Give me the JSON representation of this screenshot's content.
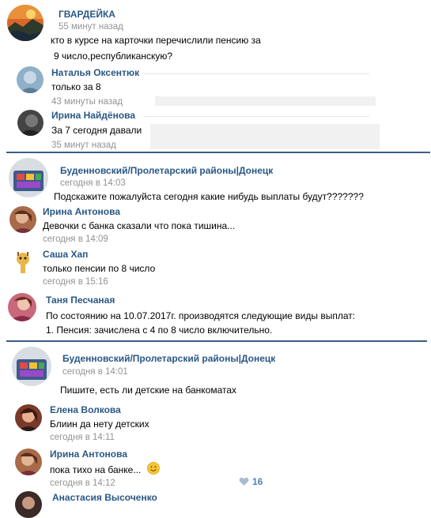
{
  "colors": {
    "link": "#2a5885",
    "time": "#939393",
    "separator": "#3a5f85",
    "like": "#5181b8"
  },
  "post1": {
    "author": "ГВАРДЕЙКА",
    "time": "55 минут назад",
    "text_line1": "кто в курсе на карточки перечислили пенсию за",
    "text_line2": "9 число,республиканскую?",
    "replies": [
      {
        "name": "Наталья Оксентюк",
        "text": "только за 8",
        "time": "43 минуты назад"
      },
      {
        "name": "Ирина Найдёнова",
        "text": "За 7 сегодня давали",
        "time": "35 минут назад"
      }
    ]
  },
  "post2": {
    "author": "Буденновский/Пролетарский районы|Донецк",
    "time": "сегодня в 14:03",
    "text": "Подскажите пожалуйста сегодня какие нибудь выплаты будут???????",
    "replies": [
      {
        "name": "Ирина Антонова",
        "text": "Девочки с банка сказали что пока тишина...",
        "time": "сегодня в 14:09"
      },
      {
        "name": "Саша Хап",
        "text": "только пенсии по 8 число",
        "time": "сегодня в 15:16"
      },
      {
        "name": "Таня Песчаная",
        "text_line1": "По состоянию на 10.07.2017г. производятся следующие виды выплат:",
        "text_line2": "1. Пенсия: зачислена с 4 по 8 число включительно."
      }
    ]
  },
  "post3": {
    "author": "Буденновский/Пролетарский районы|Донецк",
    "time": "сегодня в 14:01",
    "text": "Пишите, есть ли детские на банкоматах",
    "replies": [
      {
        "name": "Елена Волкова",
        "text": "Блиин да нету детских",
        "time": "сегодня в 14:11"
      },
      {
        "name": "Ирина Антонова",
        "text": "пока тихо на банке...",
        "time": "сегодня в 14:12",
        "likes": "16"
      },
      {
        "name": "Анастасия Высоченко"
      }
    ]
  },
  "icons": {
    "like": "heart-icon",
    "emoji": "smile-emoji-icon"
  }
}
